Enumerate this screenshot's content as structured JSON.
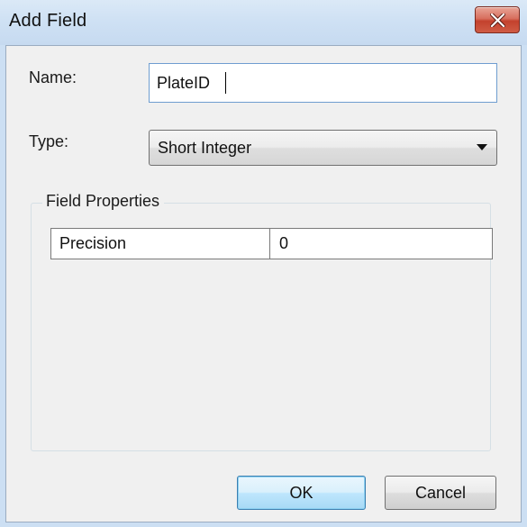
{
  "window": {
    "title": "Add Field",
    "close_icon": "close-icon"
  },
  "form": {
    "name_label": "Name:",
    "name_value": "PlateID",
    "type_label": "Type:",
    "type_value": "Short Integer",
    "type_icon": "chevron-down-icon"
  },
  "field_properties": {
    "legend": "Field Properties",
    "rows": [
      {
        "property": "Precision",
        "value": "0"
      }
    ]
  },
  "buttons": {
    "ok_label": "OK",
    "cancel_label": "Cancel"
  },
  "colors": {
    "title_bar": "#cfe1f4",
    "close_button": "#c3412d",
    "focus_border": "#6f9dd0",
    "default_button": "#bee6fd"
  }
}
